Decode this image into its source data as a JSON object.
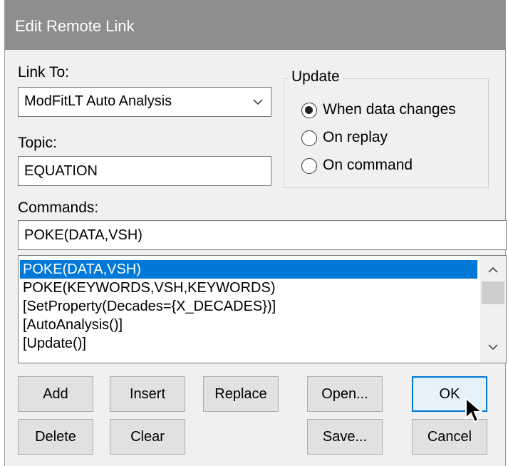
{
  "window": {
    "title": "Edit Remote Link"
  },
  "link_to": {
    "label": "Link To:",
    "value": "ModFitLT Auto Analysis"
  },
  "topic": {
    "label": "Topic:",
    "value": "EQUATION"
  },
  "update": {
    "label": "Update",
    "options": [
      {
        "label": "When data changes",
        "selected": true
      },
      {
        "label": "On replay",
        "selected": false
      },
      {
        "label": "On command",
        "selected": false
      }
    ]
  },
  "commands": {
    "label": "Commands:",
    "value": "POKE(DATA,VSH)",
    "items": [
      "POKE(DATA,VSH)",
      "POKE(KEYWORDS,VSH,KEYWORDS)",
      "[SetProperty(Decades={X_DECADES})]",
      "[AutoAnalysis()]",
      "[Update()]"
    ],
    "selected_index": 0
  },
  "buttons": {
    "add": "Add",
    "insert": "Insert",
    "replace": "Replace",
    "open": "Open...",
    "ok": "OK",
    "delete": "Delete",
    "clear": "Clear",
    "save": "Save...",
    "cancel": "Cancel"
  },
  "colors": {
    "selection": "#0078d7",
    "default_button_border": "#0078d7"
  }
}
